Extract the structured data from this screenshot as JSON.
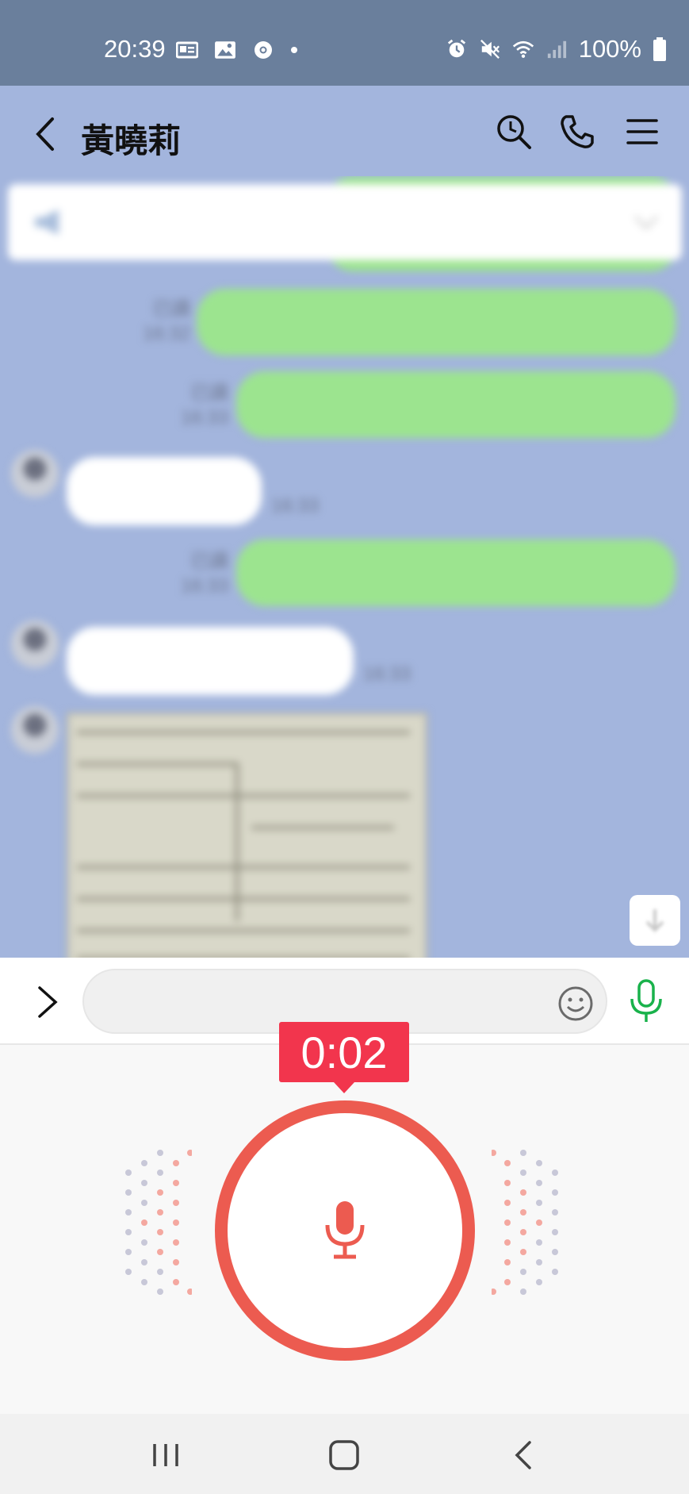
{
  "status_bar": {
    "time": "20:39",
    "battery": "100%",
    "left_icons": [
      "news-icon",
      "image-icon",
      "chrome-icon",
      "dot-icon"
    ],
    "right_icons": [
      "alarm-icon",
      "mute-icon",
      "wifi-icon",
      "signal-icon",
      "battery-icon"
    ]
  },
  "header": {
    "title": "黃曉莉",
    "icons": [
      "back-icon",
      "search-history-icon",
      "phone-icon",
      "menu-icon"
    ]
  },
  "chat": {
    "messages": [
      {
        "side": "me",
        "read": "已讀",
        "time": "16:32"
      },
      {
        "side": "me",
        "read": "已讀",
        "time": "16:33"
      },
      {
        "side": "them",
        "time": "16:33"
      },
      {
        "side": "me",
        "read": "已讀",
        "time": "16:33"
      },
      {
        "side": "them",
        "time": "16:33"
      },
      {
        "side": "them",
        "type": "image"
      }
    ]
  },
  "input": {
    "value": "",
    "placeholder": ""
  },
  "voice": {
    "timer": "0:02",
    "accent_color": "#ec5b50",
    "badge_color": "#f2354d"
  },
  "colors": {
    "bubble_me": "#9ce48f",
    "chat_bg": "#a3b5dd",
    "mic_green": "#19b24b"
  }
}
